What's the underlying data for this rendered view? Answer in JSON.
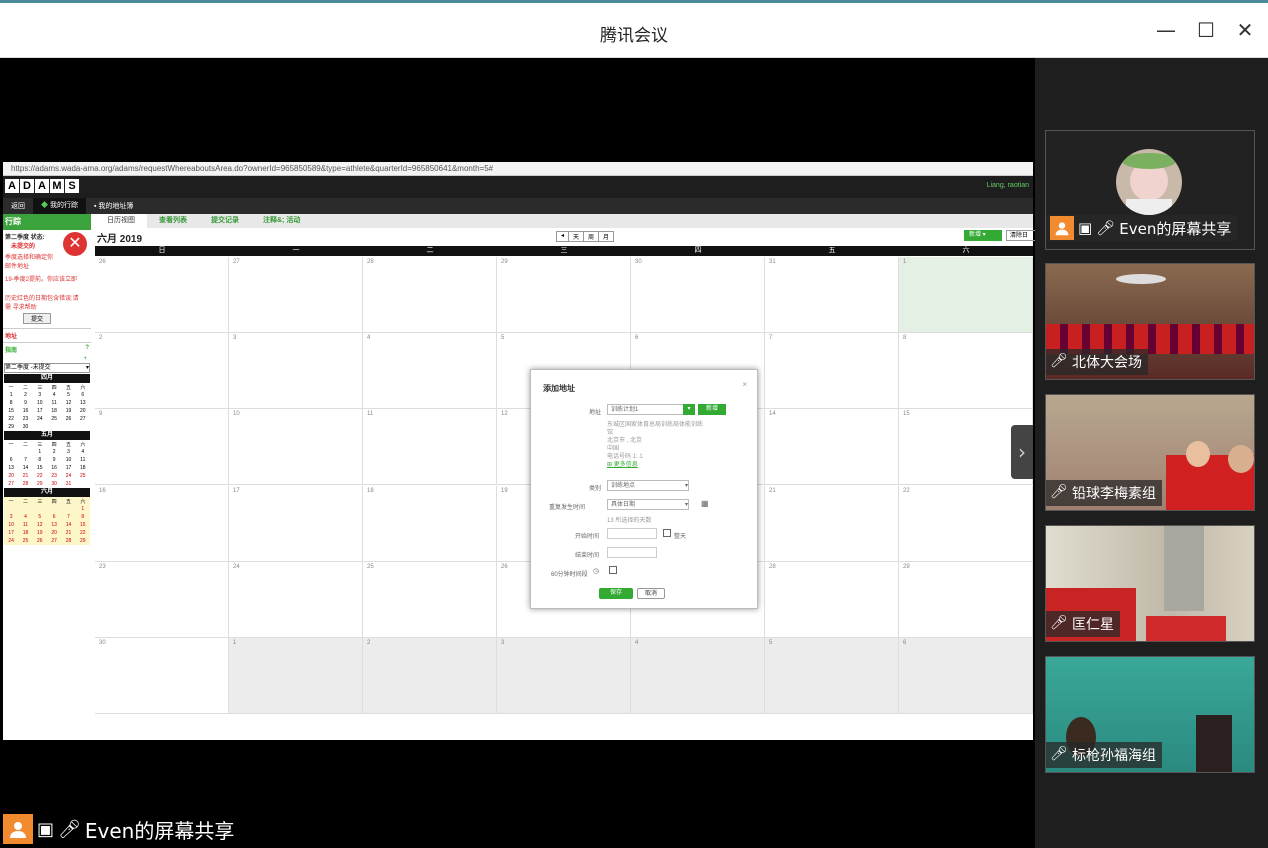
{
  "window": {
    "title": "腾讯会议",
    "minimize": "—",
    "maximize": "☐",
    "close": "✕"
  },
  "share": {
    "label": "Even的屏幕共享"
  },
  "participants": [
    {
      "name": "Even的屏幕共享",
      "muted": false
    },
    {
      "name": "北体大会场",
      "muted": true
    },
    {
      "name": "铅球李梅素组",
      "muted": true
    },
    {
      "name": "匡仁星",
      "muted": true
    },
    {
      "name": "标枪孙福海组",
      "muted": true
    }
  ],
  "browser": {
    "url": "https://adams.wada-ama.org/adams/requestWhereaboutsArea.do?ownerId=965850589&type=athlete&quarterId=965850641&month=5#",
    "logo": [
      "A",
      "D",
      "A",
      "M",
      "S"
    ],
    "user": "Liang, raotian",
    "nav": [
      "返回",
      "我的行踪",
      "我的地址簿"
    ],
    "sidebar": {
      "header": "行踪",
      "status_lines": [
        "第二季度 状态:",
        "未提交的"
      ],
      "notes": [
        "季度选择和确定你",
        "邮件地址",
        "19-季度2提前。你应该立即",
        "历史红色的日期包含错误;请",
        "需 寻求帮助"
      ],
      "submit": "提交",
      "address_hdr": "地址",
      "guide_hdr": "指南",
      "quarter_select": "第二季度 -未提交",
      "months": [
        {
          "name": "四月",
          "rows": [
            [
              "1",
              "2",
              "3",
              "4",
              "5",
              "6"
            ],
            [
              "8",
              "9",
              "10",
              "11",
              "12",
              "13"
            ],
            [
              "15",
              "16",
              "17",
              "18",
              "19",
              "20"
            ],
            [
              "22",
              "23",
              "24",
              "25",
              "26",
              "27"
            ],
            [
              "29",
              "30",
              "",
              "",
              "",
              ""
            ]
          ]
        },
        {
          "name": "五月",
          "rows": [
            [
              "",
              "",
              "1",
              "2",
              "3",
              "4"
            ],
            [
              "6",
              "7",
              "8",
              "9",
              "10",
              "11"
            ],
            [
              "13",
              "14",
              "15",
              "16",
              "17",
              "18"
            ],
            [
              "20",
              "21",
              "22",
              "23",
              "24",
              "25"
            ],
            [
              "27",
              "28",
              "29",
              "30",
              "31",
              ""
            ]
          ]
        },
        {
          "name": "六月",
          "rows": [
            [
              "",
              "",
              "",
              "",
              "",
              "1"
            ],
            [
              "3",
              "4",
              "5",
              "6",
              "7",
              "8"
            ],
            [
              "10",
              "11",
              "12",
              "13",
              "14",
              "15"
            ],
            [
              "17",
              "18",
              "19",
              "20",
              "21",
              "22"
            ],
            [
              "24",
              "25",
              "26",
              "27",
              "28",
              "29"
            ]
          ]
        }
      ],
      "weekdays": [
        "一",
        "二",
        "三",
        "四",
        "五",
        "六"
      ]
    },
    "tabs": [
      "日历视图",
      "查看列表",
      "提交记录",
      "注释&; 活动"
    ],
    "month_title": "六月 2019",
    "view_buttons": [
      "天",
      "周",
      "月"
    ],
    "new_button": "新增",
    "clear_button": "清除日",
    "weekday_headers": [
      "日",
      "一",
      "二",
      "三",
      "四",
      "五",
      "六"
    ],
    "weeks": [
      [
        "26",
        "27",
        "28",
        "29",
        "30",
        "31",
        "1"
      ],
      [
        "2",
        "3",
        "4",
        "5",
        "6",
        "7",
        "8"
      ],
      [
        "9",
        "10",
        "11",
        "12",
        "13",
        "14",
        "15"
      ],
      [
        "16",
        "17",
        "18",
        "19",
        "20",
        "21",
        "22"
      ],
      [
        "23",
        "24",
        "25",
        "26",
        "27",
        "28",
        "29"
      ],
      [
        "30",
        "1",
        "2",
        "3",
        "4",
        "5",
        "6"
      ]
    ],
    "modal": {
      "title": "添加地址",
      "address_label": "地址",
      "address_value": "训练计划1",
      "new_btn": "新增",
      "address_lines": [
        "东城区国家体育总局训练局体能训练",
        "馆",
        "北京市 , 北京",
        "中国",
        "电话号码 1: 1"
      ],
      "more_info": "更多信息",
      "type_label": "类别",
      "type_value": "训练地点",
      "repeat_label": "重复发生时间",
      "repeat_value": "具体日期",
      "selected_days": "13 所选择的天数",
      "start_label": "开始时间",
      "allday": "整天",
      "end_label": "结束时间",
      "slot_label": "60分钟时间段",
      "save": "保存",
      "cancel": "取消"
    }
  }
}
